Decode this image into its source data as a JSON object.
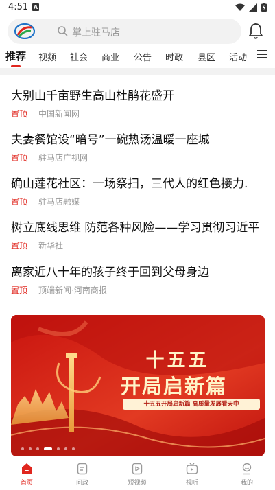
{
  "status_bar": {
    "time": "4:51",
    "badge": "A"
  },
  "search": {
    "placeholder": "掌上驻马店"
  },
  "tabs": [
    {
      "label": "推荐",
      "active": true
    },
    {
      "label": "视频"
    },
    {
      "label": "社会"
    },
    {
      "label": "商业"
    },
    {
      "label": "公告"
    },
    {
      "label": "时政"
    },
    {
      "label": "县区"
    },
    {
      "label": "活动"
    }
  ],
  "news": [
    {
      "title": "大别山千亩野生高山杜鹃花盛开",
      "tag": "置顶",
      "source": "中国新闻网"
    },
    {
      "title": "夫妻餐馆设“暗号”一碗热汤温暖一座城",
      "tag": "置顶",
      "source": "驻马店广视网"
    },
    {
      "title": "确山莲花社区：一场祭扫，三代人的红色接力.",
      "tag": "置顶",
      "source": "驻马店融媒"
    },
    {
      "title": "树立底线思维 防范各种风险——学习贯彻习近平",
      "tag": "置顶",
      "source": "新华社"
    },
    {
      "title": "离家近八十年的孩子终于回到父母身边",
      "tag": "置顶",
      "source": "顶端新闻·河南商报"
    }
  ],
  "banner": {
    "line1": "十五五",
    "line2": "开局启新篇",
    "tagline": "十五五开局启新篇 高质量发展看天中",
    "slide_count": 7,
    "active_slide": 4
  },
  "bottom_nav": [
    {
      "label": "首页",
      "icon": "home-icon",
      "active": true
    },
    {
      "label": "问政",
      "icon": "document-icon"
    },
    {
      "label": "短视频",
      "icon": "play-icon"
    },
    {
      "label": "视听",
      "icon": "tv-icon"
    },
    {
      "label": "我的",
      "icon": "profile-icon"
    }
  ],
  "colors": {
    "accent": "#e0261e",
    "banner_red": "#d9221a"
  }
}
